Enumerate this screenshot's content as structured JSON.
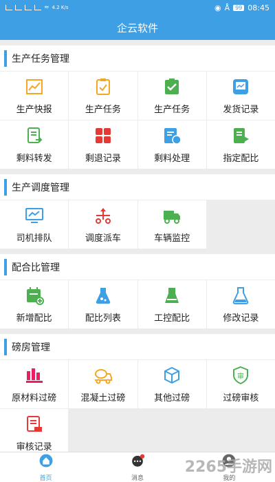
{
  "status": {
    "speed": "4.2\nK/s",
    "battery": "99",
    "time": "08:45"
  },
  "title": "企云软件",
  "sections": [
    {
      "title": "生产任务管理",
      "items": [
        {
          "label": "生产快报",
          "icon": "chart-icon",
          "color": "#f5a623"
        },
        {
          "label": "生产任务",
          "icon": "clipboard-icon",
          "color": "#f5a623"
        },
        {
          "label": "生产任务",
          "icon": "clipboard-check-icon",
          "color": "#4caf50"
        },
        {
          "label": "发货记录",
          "icon": "chart-board-icon",
          "color": "#3f9fe5"
        },
        {
          "label": "剩料转发",
          "icon": "document-forward-icon",
          "color": "#4caf50"
        },
        {
          "label": "剩退记录",
          "icon": "apps-grid-icon",
          "color": "#e53935"
        },
        {
          "label": "剩料处理",
          "icon": "edit-doc-icon",
          "color": "#3f9fe5"
        },
        {
          "label": "指定配比",
          "icon": "flag-doc-icon",
          "color": "#4caf50"
        }
      ]
    },
    {
      "title": "生产调度管理",
      "items": [
        {
          "label": "司机排队",
          "icon": "monitor-icon",
          "color": "#3f9fe5"
        },
        {
          "label": "调度派车",
          "icon": "dispatch-icon",
          "color": "#e53935"
        },
        {
          "label": "车辆监控",
          "icon": "truck-icon",
          "color": "#4caf50"
        }
      ]
    },
    {
      "title": "配合比管理",
      "items": [
        {
          "label": "新增配比",
          "icon": "calendar-add-icon",
          "color": "#4caf50"
        },
        {
          "label": "配比列表",
          "icon": "flask-icon",
          "color": "#3f9fe5"
        },
        {
          "label": "工控配比",
          "icon": "beaker-icon",
          "color": "#4caf50"
        },
        {
          "label": "修改记录",
          "icon": "flask-edit-icon",
          "color": "#3f9fe5"
        }
      ]
    },
    {
      "title": "磅房管理",
      "items": [
        {
          "label": "原材料过磅",
          "icon": "material-scale-icon",
          "color": "#e91e63"
        },
        {
          "label": "混凝土过磅",
          "icon": "mixer-truck-icon",
          "color": "#f5a623"
        },
        {
          "label": "其他过磅",
          "icon": "box-icon",
          "color": "#3f9fe5"
        },
        {
          "label": "过磅审核",
          "icon": "shield-audit-icon",
          "color": "#4caf50"
        },
        {
          "label": "审核记录",
          "icon": "audit-record-icon",
          "color": "#e53935"
        }
      ]
    }
  ],
  "tabs": [
    {
      "label": "首页",
      "icon": "home-icon",
      "active": true
    },
    {
      "label": "消息",
      "icon": "message-icon",
      "active": false
    },
    {
      "label": "我的",
      "icon": "profile-icon",
      "active": false
    }
  ],
  "watermark": "2265手游网"
}
